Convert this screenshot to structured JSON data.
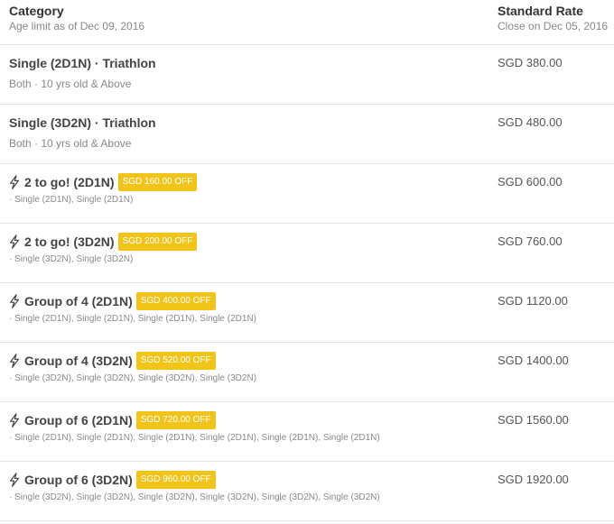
{
  "header": {
    "category_title": "Category",
    "category_sub": "Age limit as of Dec 09, 2016",
    "rate_title": "Standard Rate",
    "rate_sub": "Close on Dec 05, 2016"
  },
  "rows": [
    {
      "name": "Single (2D1N) · Triathlon",
      "icon": null,
      "badge": null,
      "desc": "Both · 10 yrs old & Above",
      "price": "SGD 380.00"
    },
    {
      "name": "Single (3D2N) · Triathlon",
      "icon": null,
      "badge": null,
      "desc": "Both · 10 yrs old & Above",
      "price": "SGD 480.00"
    },
    {
      "name": "2 to go! (2D1N)",
      "icon": "lightning-bolt-icon",
      "badge": "SGD 160.00 OFF",
      "desc": "· Single (2D1N), Single (2D1N)",
      "price": "SGD 600.00"
    },
    {
      "name": "2 to go! (3D2N)",
      "icon": "lightning-bolt-icon",
      "badge": "SGD 200.00 OFF",
      "desc": "· Single (3D2N), Single (3D2N)",
      "price": "SGD 760.00"
    },
    {
      "name": "Group of 4 (2D1N)",
      "icon": "lightning-bolt-icon",
      "badge": "SGD 400.00 OFF",
      "desc": "· Single (2D1N), Single (2D1N), Single (2D1N), Single (2D1N)",
      "price": "SGD 1120.00"
    },
    {
      "name": "Group of 4 (3D2N)",
      "icon": "lightning-bolt-icon",
      "badge": "SGD 520.00 OFF",
      "desc": "· Single (3D2N), Single (3D2N), Single (3D2N), Single (3D2N)",
      "price": "SGD 1400.00"
    },
    {
      "name": "Group of 6 (2D1N)",
      "icon": "lightning-bolt-icon",
      "badge": "SGD 720.00 OFF",
      "desc": "· Single (2D1N), Single (2D1N), Single (2D1N), Single (2D1N), Single (2D1N), Single (2D1N)",
      "price": "SGD 1560.00"
    },
    {
      "name": "Group of 6 (3D2N)",
      "icon": "lightning-bolt-icon",
      "badge": "SGD 960.00 OFF",
      "desc": "· Single (3D2N), Single (3D2N), Single (3D2N), Single (3D2N), Single (3D2N), Single (3D2N)",
      "price": "SGD 1920.00"
    }
  ],
  "colors": {
    "badge_bg": "#f0c419",
    "divider": "#e6e6e6",
    "muted_text": "#888888"
  }
}
